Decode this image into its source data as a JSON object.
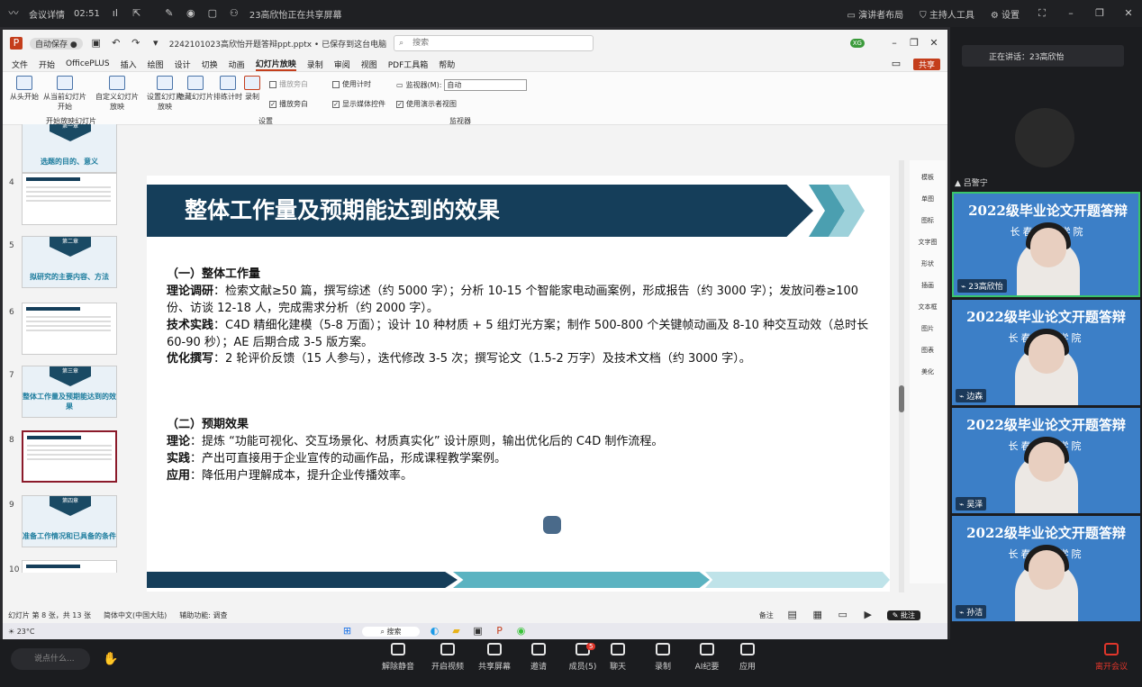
{
  "topbar": {
    "app": "会议详情",
    "time": "02:51",
    "share_status": "23高欣怡正在共享屏幕",
    "layout": "演讲者布局",
    "host_tools": "主持人工具",
    "settings": "设置"
  },
  "ppt": {
    "filename": "2242101023高欣怡开题答辩ppt.pptx • 已保存到这台电脑",
    "search_placeholder": "搜索",
    "user_initials": "XG",
    "share_btn": "共享",
    "menu": [
      "文件",
      "开始",
      "OfficePLUS",
      "插入",
      "绘图",
      "设计",
      "切换",
      "动画",
      "幻灯片放映",
      "录制",
      "审阅",
      "视图",
      "PDF工具箱",
      "帮助"
    ],
    "active_menu": "幻灯片放映",
    "ribbon": {
      "from_start": "从头开始",
      "from_current": "从当前幻灯片开始",
      "custom": "自定义幻灯片放映",
      "group1": "开始放映幻灯片",
      "setup": "设置幻灯片放映",
      "hide": "隐藏幻灯片",
      "rehearse": "排练计时",
      "record": "录制",
      "play_narr": "播放旁白",
      "use_timing": "使用计时",
      "show_media": "显示媒体控件",
      "group2": "设置",
      "monitor_label": "监视器(M):",
      "monitor_value": "自动",
      "presenter_view": "使用演示者视图",
      "group3": "监视器"
    },
    "thumbs": [
      {
        "n": "",
        "label": "选题的目的、意义",
        "type": "sec",
        "chev": "第一章"
      },
      {
        "n": "4",
        "label": "",
        "type": "text"
      },
      {
        "n": "5",
        "label": "拟研究的主要内容、方法",
        "type": "sec",
        "chev": "第二章"
      },
      {
        "n": "6",
        "label": "",
        "type": "text"
      },
      {
        "n": "7",
        "label": "整体工作量及预期能达到的效果",
        "type": "sec",
        "chev": "第三章"
      },
      {
        "n": "8",
        "label": "",
        "type": "sel"
      },
      {
        "n": "9",
        "label": "准备工作情况和已具备的条件",
        "type": "sec",
        "chev": "第四章"
      },
      {
        "n": "10",
        "label": "",
        "type": "text"
      }
    ],
    "slide": {
      "title": "整体工作量及预期能达到的效果",
      "s1_head": "（一）整体工作量",
      "s1_l1_k": "理论调研",
      "s1_l1": "：检索文献≥50 篇，撰写综述（约 5000 字）；分析 10-15 个智能家电动画案例，形成报告（约 3000 字）；发放问卷≥100 份、访谈 12-18 人，完成需求分析（约 2000 字）。",
      "s1_l2_k": "技术实践",
      "s1_l2": "：C4D 精细化建模（5-8 万面）；设计 10 种材质 + 5 组灯光方案；制作 500-800 个关键帧动画及 8-10 种交互动效（总时长 60-90 秒）；AE 后期合成 3-5 版方案。",
      "s1_l3_k": "优化撰写",
      "s1_l3": "：2 轮评价反馈（15 人参与），迭代修改 3-5 次；撰写论文（1.5-2 万字）及技术文档（约 3000 字）。",
      "s2_head": "（二）预期效果",
      "s2_l1_k": "理论",
      "s2_l1": "：提炼 “功能可视化、交互场景化、材质真实化” 设计原则，输出优化后的 C4D 制作流程。",
      "s2_l2_k": "实践",
      "s2_l2": "：产出可直接用于企业宣传的动画作品，形成课程教学案例。",
      "s2_l3_k": "应用",
      "s2_l3": "：降低用户理解成本，提升企业传播效率。"
    },
    "status": {
      "slide_no": "幻灯片 第 8 张，共 13 张",
      "lang": "简体中文(中国大陆)",
      "access": "辅助功能: 调查",
      "notes": "备注",
      "annotate": "批注"
    },
    "taskbar": {
      "weather": "23°C",
      "search": "搜索"
    },
    "sidepanel": [
      "模板",
      "单图",
      "图标",
      "文字图",
      "形状",
      "插画",
      "文本框",
      "图片",
      "图表",
      "美化"
    ]
  },
  "right": {
    "speaking": "正在讲话：23高欣怡",
    "top_name": "吕警宁",
    "banner": "2022级毕业论文开题答辩",
    "sub": "长春人文学院",
    "tiles": [
      {
        "name": "23高欣怡"
      },
      {
        "name": "边森"
      },
      {
        "name": "吴泽"
      },
      {
        "name": "孙洁"
      }
    ]
  },
  "bottom": {
    "chat_placeholder": "说点什么...",
    "buttons": [
      "解除静音",
      "开启视频",
      "共享屏幕",
      "邀请",
      "成员(5)",
      "聊天",
      "录制",
      "AI纪要",
      "应用"
    ],
    "members_badge": "5",
    "leave": "离开会议"
  },
  "colors": {
    "title_band": "#153e5a",
    "accent_teal": "#5bb3c1",
    "tile_bg": "#3c7fc7",
    "leave": "#e0362b"
  }
}
